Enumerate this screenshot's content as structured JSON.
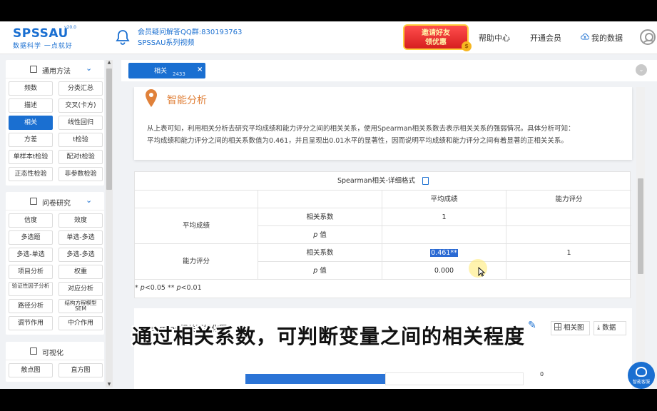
{
  "header": {
    "logo_text": "SPSSAU",
    "logo_version": "v20.0",
    "logo_sub": "数据科学 一点就好",
    "notice_line1": "会员疑问解答QQ群:830193763",
    "notice_line2": "SPSSAU系列视频",
    "promo_line1": "邀请好友",
    "promo_line2": "领优惠",
    "promo_coin": "$",
    "nav_help": "帮助中心",
    "nav_vip": "开通会员",
    "nav_data": "我的数据"
  },
  "sidebar": {
    "sections": [
      {
        "title": "通用方法",
        "items": [
          "频数",
          "分类汇总",
          "描述",
          "交叉(卡方)",
          "相关",
          "线性回归",
          "方差",
          "t检验",
          "单样本t检验",
          "配对t检验",
          "正态性检验",
          "非参数检验"
        ]
      },
      {
        "title": "问卷研究",
        "items": [
          "信度",
          "效度",
          "多选题",
          "单选-多选",
          "多选-单选",
          "多选-多选",
          "项目分析",
          "权重",
          "验证性因子分析",
          "对应分析",
          "路径分析",
          "结构方程模型SEM",
          "调节作用",
          "中介作用"
        ]
      },
      {
        "title": "可视化",
        "items": [
          "散点图",
          "直方图"
        ]
      }
    ],
    "active_item": "相关"
  },
  "tabbar": {
    "tab_label": "相关",
    "tab_count": "2433",
    "tab_close": "×",
    "dropdown": "⌄"
  },
  "analysis": {
    "title": "智能分析",
    "text_line1": "从上表可知，利用相关分析去研究平均成绩和能力评分之间的相关关系，使用Spearman相关系数去表示相关关系的强弱情况。具体分析可知：",
    "text_line2": "平均成绩和能力评分之间的相关系数值为0.461，并且呈现出0.01水平的显著性，因而说明平均成绩和能力评分之间有着显著的正相关关系。"
  },
  "table": {
    "title": "Spearman相关-详细格式",
    "col_headers": [
      "平均成绩",
      "能力评分"
    ],
    "rows": [
      {
        "var": "平均成绩",
        "stat1": "相关系数",
        "v1": "1",
        "v2": "",
        "stat2": "p 值",
        "p1": "",
        "p2": ""
      },
      {
        "var": "能力评分",
        "stat1": "相关系数",
        "v1": "0.461**",
        "v2": "1",
        "stat2": "p 值",
        "p1": "0.000",
        "p2": ""
      }
    ],
    "p_label": "值",
    "p_italic": "p",
    "note_part1": "* ",
    "note_p1": "p",
    "note_part2": "<0.05 ** ",
    "note_p2": "p",
    "note_part3": "<0.01"
  },
  "viz": {
    "title": "Spearman相关可视化图",
    "btn_heatmap": "相关图",
    "btn_data": "数据",
    "axis_zero": "0"
  },
  "overlay": {
    "subtitle": "通过相关系数，可判断变量之间的相关程度",
    "float_btn": "智能客服"
  },
  "colors": {
    "brand": "#1a6fd1",
    "accent_orange": "#e0813a",
    "highlight": "#2b6ad3"
  }
}
